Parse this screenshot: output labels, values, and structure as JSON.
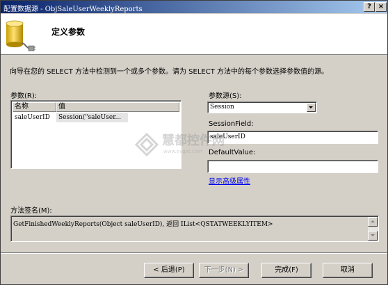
{
  "window": {
    "title": "配置数据源 - ObjSaleUserWeeklyReports",
    "help_label": "?",
    "close_label": "×"
  },
  "header": {
    "title": "定义参数"
  },
  "description": "向导在您的 SELECT 方法中检测到一个或多个参数。请为 SELECT 方法中的每个参数选择参数值的源。",
  "parameters": {
    "label": "参数(R):",
    "columns": [
      "名称",
      "值"
    ],
    "rows": [
      {
        "name": "saleUserID",
        "value": "Session(\"saleUser..."
      }
    ]
  },
  "source": {
    "label": "参数源(S):",
    "selected": "Session"
  },
  "session_field": {
    "label": "SessionField:",
    "value": "saleUserID"
  },
  "default_value": {
    "label": "DefaultValue:",
    "value": ""
  },
  "advanced_link": "显示高级属性",
  "signature": {
    "label": "方法签名(M):",
    "text": "GetFinishedWeeklyReports(Object saleUserID), 返回 IList<QSTATWEEKLYITEM>"
  },
  "buttons": {
    "back": "< 后退(P)",
    "next": "下一步(N) >",
    "finish": "完成(F)",
    "cancel": "取消"
  },
  "watermark": {
    "text": "慧都控件网",
    "sub": "www.evget.com"
  }
}
